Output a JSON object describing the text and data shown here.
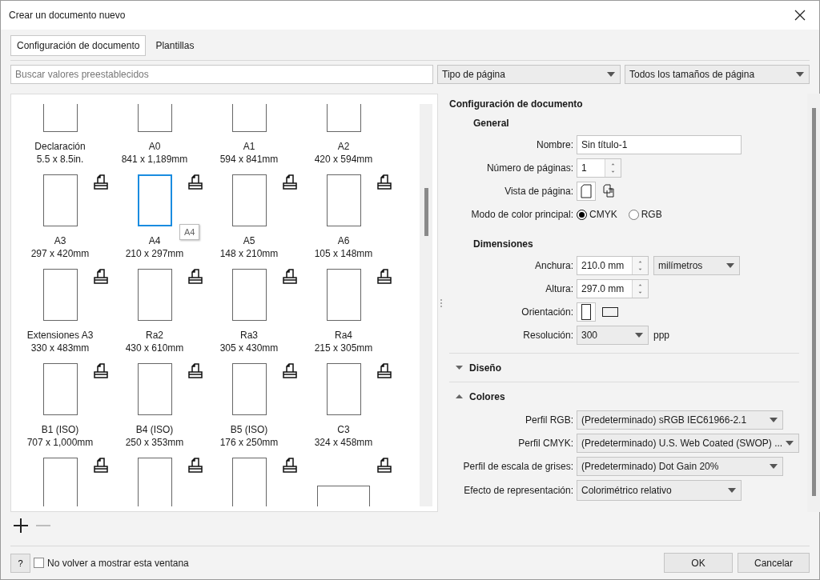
{
  "window": {
    "title": "Crear un documento nuevo"
  },
  "tabs": [
    {
      "label": "Configuración de documento",
      "selected": true
    },
    {
      "label": "Plantillas",
      "selected": false
    }
  ],
  "search": {
    "placeholder": "Buscar valores preestablecidos"
  },
  "filters": [
    {
      "value": "Tipo de página"
    },
    {
      "value": "Todos los tamaños de página"
    }
  ],
  "presets": [
    {
      "name": "Declaración",
      "size": "5.5 x 8.5in.",
      "kind": "portrait",
      "printable": false,
      "selected": false
    },
    {
      "name": "A0",
      "size": "841 x 1,189mm",
      "kind": "portrait",
      "printable": false,
      "selected": false
    },
    {
      "name": "A1",
      "size": "594 x 841mm",
      "kind": "portrait",
      "printable": false,
      "selected": false
    },
    {
      "name": "A2",
      "size": "420 x 594mm",
      "kind": "portrait",
      "printable": false,
      "selected": false
    },
    {
      "name": "A3",
      "size": "297 x 420mm",
      "kind": "portrait",
      "printable": true,
      "selected": false
    },
    {
      "name": "A4",
      "size": "210 x 297mm",
      "kind": "portrait",
      "printable": true,
      "selected": true
    },
    {
      "name": "A5",
      "size": "148 x 210mm",
      "kind": "portrait",
      "printable": true,
      "selected": false
    },
    {
      "name": "A6",
      "size": "105 x 148mm",
      "kind": "portrait",
      "printable": true,
      "selected": false
    },
    {
      "name": "Extensiones A3",
      "size": "330 x 483mm",
      "kind": "portrait",
      "printable": true,
      "selected": false
    },
    {
      "name": "Ra2",
      "size": "430 x 610mm",
      "kind": "portrait",
      "printable": true,
      "selected": false
    },
    {
      "name": "Ra3",
      "size": "305 x 430mm",
      "kind": "portrait",
      "printable": true,
      "selected": false
    },
    {
      "name": "Ra4",
      "size": "215 x 305mm",
      "kind": "portrait",
      "printable": true,
      "selected": false
    },
    {
      "name": "B1 (ISO)",
      "size": "707 x 1,000mm",
      "kind": "portrait",
      "printable": true,
      "selected": false
    },
    {
      "name": "B4 (ISO)",
      "size": "250 x 353mm",
      "kind": "portrait",
      "printable": true,
      "selected": false
    },
    {
      "name": "B5 (ISO)",
      "size": "176 x 250mm",
      "kind": "portrait",
      "printable": true,
      "selected": false
    },
    {
      "name": "C3",
      "size": "324 x 458mm",
      "kind": "portrait",
      "printable": true,
      "selected": false
    },
    {
      "kind": "portrait",
      "printable": true,
      "selected": false
    },
    {
      "kind": "portrait",
      "printable": true,
      "selected": false
    },
    {
      "kind": "portrait",
      "printable": true,
      "selected": false
    },
    {
      "kind": "landscape",
      "printable": true,
      "selected": false
    }
  ],
  "preset_tooltip": {
    "text": "A4"
  },
  "preset_buttons": [
    {
      "kind": "add",
      "disabled": false
    },
    {
      "kind": "remove",
      "disabled": true
    }
  ],
  "settings": {
    "title": "Configuración de documento",
    "sections": [
      {
        "title": "General",
        "kind": "plain",
        "rows": [
          {
            "kind": "text",
            "label": "Nombre:",
            "value": "Sin título-1"
          },
          {
            "kind": "spin",
            "label": "Número de páginas:",
            "value": "1"
          },
          {
            "kind": "icons",
            "label": "Vista de página:",
            "options": [
              {
                "kind": "single-page",
                "selected": true
              },
              {
                "kind": "multi-page",
                "selected": false
              }
            ]
          },
          {
            "kind": "radio",
            "label": "Modo de color principal:",
            "options": [
              {
                "label": "CMYK",
                "selected": true
              },
              {
                "label": "RGB",
                "selected": false
              }
            ]
          }
        ]
      },
      {
        "title": "Dimensiones",
        "kind": "plain",
        "rows": [
          {
            "kind": "spin-wide",
            "label": "Anchura:",
            "value": "210.0 mm",
            "unit": "milímetros"
          },
          {
            "kind": "spin-wide",
            "label": "Altura:",
            "value": "297.0 mm"
          },
          {
            "kind": "icons",
            "label": "Orientación:",
            "options": [
              {
                "kind": "portrait",
                "selected": true
              },
              {
                "kind": "landscape",
                "selected": false
              }
            ]
          },
          {
            "kind": "combo",
            "label": "Resolución:",
            "value": "300",
            "suffix": "ppp"
          }
        ]
      },
      {
        "title": "Diseño",
        "kind": "collapsible",
        "expanded": false
      },
      {
        "title": "Colores",
        "kind": "collapsible",
        "expanded": true,
        "rows": [
          {
            "kind": "select",
            "label": "Perfil RGB:",
            "value": "(Predeterminado) sRGB IEC61966-2.1"
          },
          {
            "kind": "select",
            "label": "Perfil CMYK:",
            "value": "(Predeterminado) U.S. Web Coated (SWOP) ..."
          },
          {
            "kind": "select",
            "label": "Perfil de escala de grises:",
            "value": "(Predeterminado) Dot Gain 20%"
          },
          {
            "kind": "select-short",
            "label": "Efecto de representación:",
            "value": "Colorimétrico relativo"
          }
        ]
      }
    ]
  },
  "footer": {
    "help": "?",
    "checkbox": {
      "label": "No volver a mostrar esta ventana",
      "checked": false
    },
    "buttons": [
      "OK",
      "Cancelar"
    ]
  }
}
